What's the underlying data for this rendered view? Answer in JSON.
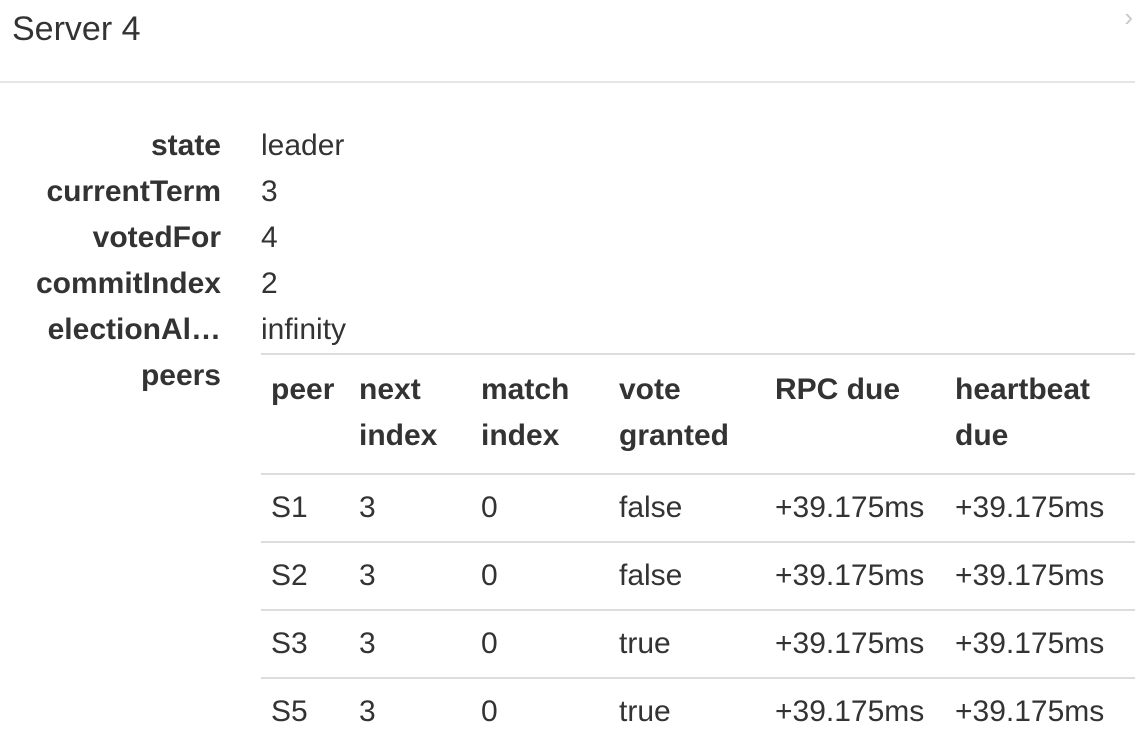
{
  "header": {
    "title": "Server 4",
    "close_glyph": "›"
  },
  "properties": [
    {
      "key": "state",
      "value": "leader"
    },
    {
      "key": "currentTerm",
      "value": "3"
    },
    {
      "key": "votedFor",
      "value": "4"
    },
    {
      "key": "commitIndex",
      "value": "2"
    },
    {
      "key": "electionAl…",
      "value": "infinity"
    }
  ],
  "peers": {
    "key": "peers",
    "columns": [
      {
        "line1": "peer",
        "line2": ""
      },
      {
        "line1": "next",
        "line2": "index"
      },
      {
        "line1": "match",
        "line2": "index"
      },
      {
        "line1": "vote",
        "line2": "granted"
      },
      {
        "line1": "RPC due",
        "line2": ""
      },
      {
        "line1": "heartbeat",
        "line2": "due"
      }
    ],
    "rows": [
      {
        "peer": "S1",
        "next_index": "3",
        "match_index": "0",
        "vote_granted": "false",
        "rpc_due": "+39.175ms",
        "heartbeat_due": "+39.175ms"
      },
      {
        "peer": "S2",
        "next_index": "3",
        "match_index": "0",
        "vote_granted": "false",
        "rpc_due": "+39.175ms",
        "heartbeat_due": "+39.175ms"
      },
      {
        "peer": "S3",
        "next_index": "3",
        "match_index": "0",
        "vote_granted": "true",
        "rpc_due": "+39.175ms",
        "heartbeat_due": "+39.175ms"
      },
      {
        "peer": "S5",
        "next_index": "3",
        "match_index": "0",
        "vote_granted": "true",
        "rpc_due": "+39.175ms",
        "heartbeat_due": "+39.175ms"
      }
    ]
  }
}
